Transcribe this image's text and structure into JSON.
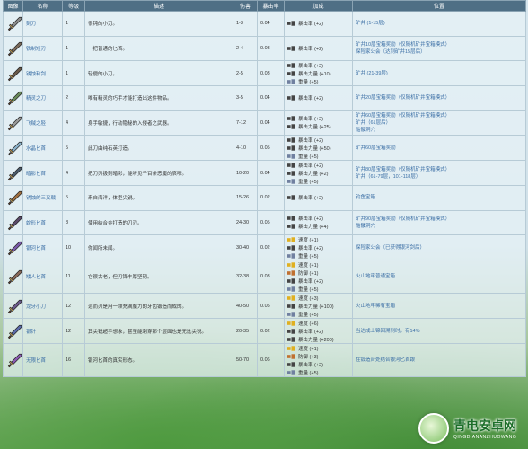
{
  "headers": {
    "icon": "图像",
    "name": "名称",
    "rarity": "等级",
    "desc": "描述",
    "damage": "伤害",
    "crit": "暴击率",
    "bonus": "加成",
    "source": "位置"
  },
  "rows": [
    {
      "icon_color": "#8c8c8c",
      "name": "刻刀",
      "rarity": "1",
      "desc": "很钝的小刀。",
      "damage": "1-3",
      "crit": "0.04",
      "stats": [
        "暴击率 (+2)"
      ],
      "source": [
        "矿井 (1-15层)"
      ]
    },
    {
      "icon_color": "#7a6a5a",
      "name": "铁制短刃",
      "rarity": "1",
      "desc": "一把普通的匕首。",
      "damage": "2-4",
      "crit": "0.03",
      "stats": [
        "暴击率 (+2)"
      ],
      "source": [
        "矿井10层宝箱奖励（仅随机矿井宝箱模式）",
        "探险家公会（达到矿井15层后）"
      ]
    },
    {
      "icon_color": "#6a5a4a",
      "name": "锈蚀利剑",
      "rarity": "1",
      "desc": "轻便的小刀。",
      "damage": "2-5",
      "crit": "0.03",
      "stats": [
        "暴击率 (+2)",
        "暴击力量 (+10)",
        "重量 (+5)"
      ],
      "source": [
        "矿井 (21-39层)"
      ]
    },
    {
      "icon_color": "#6a8a5a",
      "name": "精灵之刀",
      "rarity": "2",
      "desc": "唯有精灵的巧手才能打造出这件物品。",
      "damage": "3-5",
      "crit": "0.04",
      "stats": [
        "暴击率 (+2)"
      ],
      "source": [
        "矿井20层宝箱奖励（仅随机矿井宝箱模式）"
      ]
    },
    {
      "icon_color": "#9a9a9a",
      "name": "飞贼之胫",
      "rarity": "4",
      "desc": "身手敏捷，行动隐秘的入侵者之武器。",
      "damage": "7-12",
      "crit": "0.04",
      "stats": [
        "暴击率 (+2)",
        "暴击力量 (+25)"
      ],
      "source": [
        "矿井60层宝箱奖励（仅随机矿井宝箱模式）",
        "矿井（61层后）",
        "骷髅洞穴"
      ]
    },
    {
      "icon_color": "#8ab0c8",
      "name": "水晶匕首",
      "rarity": "5",
      "desc": "此刀由纯石英打造。",
      "damage": "4-10",
      "crit": "0.05",
      "stats": [
        "暴击率 (+2)",
        "暴击力量 (+50)",
        "重量 (+5)"
      ],
      "source": [
        "矿井60层宝箱奖励"
      ]
    },
    {
      "icon_color": "#4a5a6a",
      "name": "暗影匕首",
      "rarity": "4",
      "desc": "把刀刃扱刻暗影，能听见千百条恶魔的哀嚎。",
      "damage": "10-20",
      "crit": "0.04",
      "stats": [
        "暴击率 (+2)",
        "暴击力量 (+2)",
        "重量 (+5)"
      ],
      "source": [
        "矿井80层宝箱奖励（仅随机矿井宝箱模式）",
        "矿井（61-79层，101-118层）"
      ]
    },
    {
      "icon_color": "#a07040",
      "name": "锈蚀的三叉戟",
      "rarity": "5",
      "desc": "来自海洋，体型尖锐。",
      "damage": "15-26",
      "crit": "0.02",
      "stats": [
        "暴击率 (+2)"
      ],
      "source": [
        "钓鱼宝箱"
      ]
    },
    {
      "icon_color": "#5a4a6a",
      "name": "蛇形匕首",
      "rarity": "8",
      "desc": "使用结合金打造的刀刃。",
      "damage": "24-30",
      "crit": "0.05",
      "stats": [
        "暴击率 (+2)",
        "暴击力量 (+4)"
      ],
      "source": [
        "矿井90层宝箱奖励（仅随机矿井宝箱模式）",
        "骷髅洞穴"
      ]
    },
    {
      "icon_color": "#7a5aa8",
      "name": "银河匕首",
      "rarity": "10",
      "desc": "你闻所未闻。",
      "damage": "30-40",
      "crit": "0.02",
      "stats": [
        "速度 (+1)",
        "暴击率 (+2)",
        "重量 (+5)"
      ],
      "source": [
        "探险家公会（已获得银河剑后）"
      ]
    },
    {
      "icon_color": "#8a6a5a",
      "name": "矮人匕首",
      "rarity": "11",
      "desc": "它很古老，但刃锋丰厚坚韧。",
      "damage": "32-38",
      "crit": "0.03",
      "stats": [
        "速度 (+1)",
        "防御 (+1)",
        "暴击率 (+2)",
        "重量 (+5)"
      ],
      "source": [
        "火山地牢普通宝箱"
      ]
    },
    {
      "icon_color": "#6a5a8a",
      "name": "龙牙小刀",
      "rarity": "12",
      "desc": "远而刃是用一颗充满魔力的牙齿锻造而成的。",
      "damage": "40-50",
      "crit": "0.05",
      "stats": [
        "速度 (+3)",
        "暴击力量 (+100)",
        "重量 (+5)"
      ],
      "source": [
        "火山地牢稀有宝箱"
      ]
    },
    {
      "icon_color": "#5a6aa8",
      "name": "银针",
      "rarity": "12",
      "desc": "其尖锐超乎想象，甚至能刺穿那个层面也是无比尖锐。",
      "damage": "20-35",
      "crit": "0.02",
      "stats": [
        "速度 (+6)",
        "暴击率 (+2)",
        "暴击力量 (+200)"
      ],
      "source": [
        "当达成上锦回溯到时，有14%"
      ]
    },
    {
      "icon_color": "#8a5ab0",
      "name": "无限匕首",
      "rarity": "16",
      "desc": "银河匕首的真实形态。",
      "damage": "50-70",
      "crit": "0.06",
      "stats": [
        "速度 (+1)",
        "防御 (+3)",
        "暴击率 (+2)",
        "重量 (+5)"
      ],
      "source": [
        "在锻造台处结合银河匕首跟"
      ]
    }
  ],
  "logo": {
    "main": "青电安卓网",
    "sub": "QINGDIANANZHUOWANG"
  },
  "colors": {
    "header_bg": "#4f6f85",
    "link": "#3a6ea5"
  }
}
